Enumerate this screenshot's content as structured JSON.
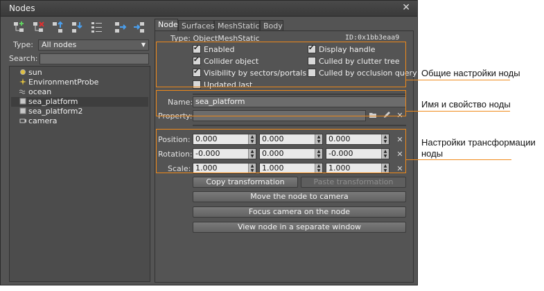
{
  "window": {
    "title": "Nodes",
    "close": "✕"
  },
  "toolbar": {
    "icons": [
      "add-node-icon",
      "delete-node-icon",
      "move-up-icon",
      "move-down-icon",
      "list-icon",
      "export-node-icon",
      "import-node-icon"
    ]
  },
  "filter": {
    "type_label": "Type:",
    "type_value": "All nodes",
    "search_label": "Search:",
    "search_value": ""
  },
  "tree": {
    "items": [
      {
        "label": "sun",
        "icon": "sun-icon"
      },
      {
        "label": "EnvironmentProbe",
        "icon": "probe-icon"
      },
      {
        "label": "ocean",
        "icon": "ocean-icon"
      },
      {
        "label": "sea_platform",
        "icon": "object-icon",
        "selected": true
      },
      {
        "label": "sea_platform2",
        "icon": "object-icon"
      },
      {
        "label": "camera",
        "icon": "camera-icon"
      }
    ]
  },
  "tabs": [
    "Node",
    "Surfaces",
    "MeshStatic",
    "Body"
  ],
  "node": {
    "type_line": "Type: ObjectMeshStatic",
    "id_line": "ID:0x1bb3eaa9",
    "checks_left": [
      {
        "label": "Enabled",
        "checked": true
      },
      {
        "label": "Collider object",
        "checked": true
      },
      {
        "label": "Visibility by sectors/portals",
        "checked": true
      },
      {
        "label": "Updated last",
        "checked": false
      }
    ],
    "checks_right": [
      {
        "label": "Display handle",
        "checked": true
      },
      {
        "label": "Culled by clutter tree",
        "checked": false
      },
      {
        "label": "Culled by occlusion query",
        "checked": false
      }
    ],
    "name_label": "Name:",
    "name_value": "sea_platform",
    "property_label": "Property:",
    "property_value": ""
  },
  "transform": {
    "position_label": "Position:",
    "rotation_label": "Rotation:",
    "scale_label": "Scale:",
    "position": [
      "0.000",
      "0.000",
      "0.000"
    ],
    "rotation": [
      "-0.000",
      "0.000",
      "-0.000"
    ],
    "scale": [
      "1.000",
      "1.000",
      "1.000"
    ]
  },
  "buttons": {
    "copy": "Copy transformation",
    "paste": "Paste transformation",
    "move": "Move the node to camera",
    "focus": "Focus camera on the node",
    "view": "View node in a separate window"
  },
  "annotations": {
    "general": "Общие настройки ноды",
    "name": "Имя и свойство ноды",
    "transform_1": "Настройки трансформации",
    "transform_2": "ноды"
  },
  "colors": {
    "accent": "#f08a1a",
    "panel": "#545454"
  }
}
